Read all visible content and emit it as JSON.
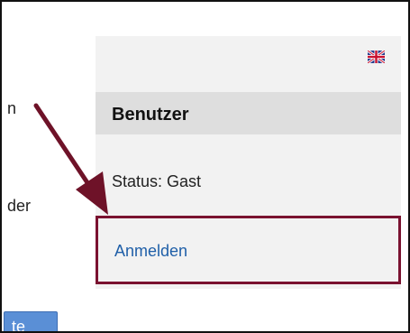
{
  "left_text": {
    "line1": "n",
    "line2": "der"
  },
  "left_button": {
    "label": "te"
  },
  "panel": {
    "language_icon": "uk-flag-icon",
    "header": "Benutzer",
    "status": "Status: Gast",
    "login_link": "Anmelden"
  },
  "colors": {
    "panel_background": "#f2f2f2",
    "header_background": "#dedede",
    "highlight_border": "#7a1230",
    "link": "#1f5fa8",
    "arrow": "#6e1228"
  }
}
